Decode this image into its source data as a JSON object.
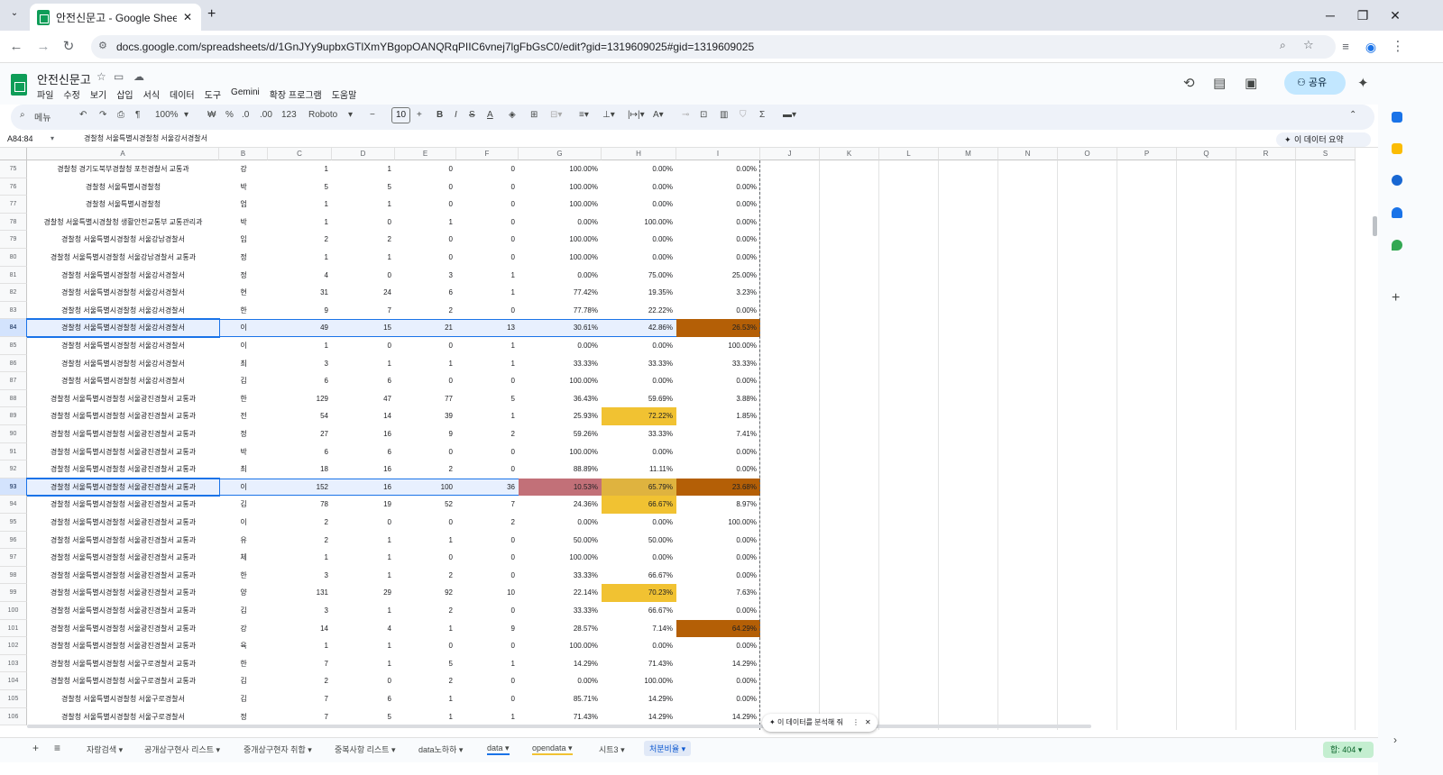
{
  "browser": {
    "tab_title": "안전신문고 - Google Sheets",
    "new_tab": "+",
    "url": "docs.google.com/spreadsheets/d/1GnJYy9upbxGTlXmYBgopOANQRqPIIC6vnej7lgFbGsC0/edit?gid=1319609025#gid=1319609025"
  },
  "app": {
    "title": "안전신문고",
    "menus": [
      "파일",
      "수정",
      "보기",
      "삽입",
      "서식",
      "데이터",
      "도구",
      "Gemini",
      "확장 프로그램",
      "도움말"
    ],
    "share_label": "공유"
  },
  "toolbar": {
    "search": "메뉴",
    "zoom": "100%",
    "currency": "₩",
    "percent": "%",
    "dec_down": ".0",
    "dec_up": ".00",
    "format_123": "123",
    "font": "Roboto",
    "font_size": "10"
  },
  "formula_bar": {
    "name_box": "A84:84",
    "content": "경찰청 서울특별시경찰청 서울강서경찰서",
    "summary_button": "이 데이터 요약"
  },
  "columns": [
    "A",
    "B",
    "C",
    "D",
    "E",
    "F",
    "G",
    "H",
    "I",
    "J",
    "K",
    "L",
    "M",
    "N",
    "O",
    "P",
    "Q",
    "R",
    "S"
  ],
  "rows": [
    {
      "n": "75",
      "a": "경찰청 경기도북부경찰청 포천경찰서 교통과",
      "b": "강",
      "c": "1",
      "d": "1",
      "e": "0",
      "f": "0",
      "g": "100.00%",
      "h": "0.00%",
      "i": "0.00%"
    },
    {
      "n": "76",
      "a": "경찰청 서울특별시경찰청",
      "b": "박",
      "c": "5",
      "d": "5",
      "e": "0",
      "f": "0",
      "g": "100.00%",
      "h": "0.00%",
      "i": "0.00%"
    },
    {
      "n": "77",
      "a": "경찰청 서울특별시경찰청",
      "b": "엄",
      "c": "1",
      "d": "1",
      "e": "0",
      "f": "0",
      "g": "100.00%",
      "h": "0.00%",
      "i": "0.00%"
    },
    {
      "n": "78",
      "a": "경찰청 서울특별시경찰청 생활안전교통부 교통관리과",
      "b": "박",
      "c": "1",
      "d": "0",
      "e": "1",
      "f": "0",
      "g": "0.00%",
      "h": "100.00%",
      "i": "0.00%"
    },
    {
      "n": "79",
      "a": "경찰청 서울특별시경찰청 서울강남경찰서",
      "b": "임",
      "c": "2",
      "d": "2",
      "e": "0",
      "f": "0",
      "g": "100.00%",
      "h": "0.00%",
      "i": "0.00%"
    },
    {
      "n": "80",
      "a": "경찰청 서울특별시경찰청 서울강남경찰서 교통과",
      "b": "정",
      "c": "1",
      "d": "1",
      "e": "0",
      "f": "0",
      "g": "100.00%",
      "h": "0.00%",
      "i": "0.00%"
    },
    {
      "n": "81",
      "a": "경찰청 서울특별시경찰청 서울강서경찰서",
      "b": "정",
      "c": "4",
      "d": "0",
      "e": "3",
      "f": "1",
      "g": "0.00%",
      "h": "75.00%",
      "i": "25.00%"
    },
    {
      "n": "82",
      "a": "경찰청 서울특별시경찰청 서울강서경찰서",
      "b": "현",
      "c": "31",
      "d": "24",
      "e": "6",
      "f": "1",
      "g": "77.42%",
      "h": "19.35%",
      "i": "3.23%"
    },
    {
      "n": "83",
      "a": "경찰청 서울특별시경찰청 서울강서경찰서",
      "b": "한",
      "c": "9",
      "d": "7",
      "e": "2",
      "f": "0",
      "g": "77.78%",
      "h": "22.22%",
      "i": "0.00%"
    },
    {
      "n": "84",
      "a": "경찰청 서울특별시경찰청 서울강서경찰서",
      "b": "이",
      "c": "49",
      "d": "15",
      "e": "21",
      "f": "13",
      "g": "30.61%",
      "h": "42.86%",
      "i": "26.53%",
      "sel": true,
      "hi": "orange"
    },
    {
      "n": "85",
      "a": "경찰청 서울특별시경찰청 서울강서경찰서",
      "b": "이",
      "c": "1",
      "d": "0",
      "e": "0",
      "f": "1",
      "g": "0.00%",
      "h": "0.00%",
      "i": "100.00%"
    },
    {
      "n": "86",
      "a": "경찰청 서울특별시경찰청 서울강서경찰서",
      "b": "최",
      "c": "3",
      "d": "1",
      "e": "1",
      "f": "1",
      "g": "33.33%",
      "h": "33.33%",
      "i": "33.33%"
    },
    {
      "n": "87",
      "a": "경찰청 서울특별시경찰청 서울강서경찰서",
      "b": "김",
      "c": "6",
      "d": "6",
      "e": "0",
      "f": "0",
      "g": "100.00%",
      "h": "0.00%",
      "i": "0.00%"
    },
    {
      "n": "88",
      "a": "경찰청 서울특별시경찰청 서울광진경찰서 교통과",
      "b": "한",
      "c": "129",
      "d": "47",
      "e": "77",
      "f": "5",
      "g": "36.43%",
      "h": "59.69%",
      "i": "3.88%"
    },
    {
      "n": "89",
      "a": "경찰청 서울특별시경찰청 서울광진경찰서 교통과",
      "b": "전",
      "c": "54",
      "d": "14",
      "e": "39",
      "f": "1",
      "g": "25.93%",
      "h": "72.22%",
      "i": "1.85%",
      "hh": "yellow"
    },
    {
      "n": "90",
      "a": "경찰청 서울특별시경찰청 서울광진경찰서 교통과",
      "b": "정",
      "c": "27",
      "d": "16",
      "e": "9",
      "f": "2",
      "g": "59.26%",
      "h": "33.33%",
      "i": "7.41%"
    },
    {
      "n": "91",
      "a": "경찰청 서울특별시경찰청 서울광진경찰서 교통과",
      "b": "박",
      "c": "6",
      "d": "6",
      "e": "0",
      "f": "0",
      "g": "100.00%",
      "h": "0.00%",
      "i": "0.00%"
    },
    {
      "n": "92",
      "a": "경찰청 서울특별시경찰청 서울광진경찰서 교통과",
      "b": "최",
      "c": "18",
      "d": "16",
      "e": "2",
      "f": "0",
      "g": "88.89%",
      "h": "11.11%",
      "i": "0.00%"
    },
    {
      "n": "93",
      "a": "경찰청 서울특별시경찰청 서울광진경찰서 교통과",
      "b": "이",
      "c": "152",
      "d": "16",
      "e": "100",
      "f": "36",
      "g": "10.53%",
      "h": "65.79%",
      "i": "23.68%",
      "sel": true,
      "hg": "red",
      "hh": "gold",
      "hi": "orange"
    },
    {
      "n": "94",
      "a": "경찰청 서울특별시경찰청 서울광진경찰서 교통과",
      "b": "김",
      "c": "78",
      "d": "19",
      "e": "52",
      "f": "7",
      "g": "24.36%",
      "h": "66.67%",
      "i": "8.97%",
      "hh": "yellow"
    },
    {
      "n": "95",
      "a": "경찰청 서울특별시경찰청 서울광진경찰서 교통과",
      "b": "이",
      "c": "2",
      "d": "0",
      "e": "0",
      "f": "2",
      "g": "0.00%",
      "h": "0.00%",
      "i": "100.00%"
    },
    {
      "n": "96",
      "a": "경찰청 서울특별시경찰청 서울광진경찰서 교통과",
      "b": "유",
      "c": "2",
      "d": "1",
      "e": "1",
      "f": "0",
      "g": "50.00%",
      "h": "50.00%",
      "i": "0.00%"
    },
    {
      "n": "97",
      "a": "경찰청 서울특별시경찰청 서울광진경찰서 교통과",
      "b": "체",
      "c": "1",
      "d": "1",
      "e": "0",
      "f": "0",
      "g": "100.00%",
      "h": "0.00%",
      "i": "0.00%"
    },
    {
      "n": "98",
      "a": "경찰청 서울특별시경찰청 서울광진경찰서 교통과",
      "b": "한",
      "c": "3",
      "d": "1",
      "e": "2",
      "f": "0",
      "g": "33.33%",
      "h": "66.67%",
      "i": "0.00%"
    },
    {
      "n": "99",
      "a": "경찰청 서울특별시경찰청 서울광진경찰서 교통과",
      "b": "양",
      "c": "131",
      "d": "29",
      "e": "92",
      "f": "10",
      "g": "22.14%",
      "h": "70.23%",
      "i": "7.63%",
      "hh": "yellow"
    },
    {
      "n": "100",
      "a": "경찰청 서울특별시경찰청 서울광진경찰서 교통과",
      "b": "김",
      "c": "3",
      "d": "1",
      "e": "2",
      "f": "0",
      "g": "33.33%",
      "h": "66.67%",
      "i": "0.00%"
    },
    {
      "n": "101",
      "a": "경찰청 서울특별시경찰청 서울광진경찰서 교통과",
      "b": "강",
      "c": "14",
      "d": "4",
      "e": "1",
      "f": "9",
      "g": "28.57%",
      "h": "7.14%",
      "i": "64.29%",
      "hi": "orange"
    },
    {
      "n": "102",
      "a": "경찰청 서울특별시경찰청 서울광진경찰서 교통과",
      "b": "육",
      "c": "1",
      "d": "1",
      "e": "0",
      "f": "0",
      "g": "100.00%",
      "h": "0.00%",
      "i": "0.00%"
    },
    {
      "n": "103",
      "a": "경찰청 서울특별시경찰청 서울구로경찰서 교통과",
      "b": "한",
      "c": "7",
      "d": "1",
      "e": "5",
      "f": "1",
      "g": "14.29%",
      "h": "71.43%",
      "i": "14.29%"
    },
    {
      "n": "104",
      "a": "경찰청 서울특별시경찰청 서울구로경찰서 교통과",
      "b": "김",
      "c": "2",
      "d": "0",
      "e": "2",
      "f": "0",
      "g": "0.00%",
      "h": "100.00%",
      "i": "0.00%"
    },
    {
      "n": "105",
      "a": "경찰청 서울특별시경찰청 서울구로경찰서",
      "b": "김",
      "c": "7",
      "d": "6",
      "e": "1",
      "f": "0",
      "g": "85.71%",
      "h": "14.29%",
      "i": "0.00%"
    },
    {
      "n": "106",
      "a": "경찰청 서울특별시경찰청 서울구로경찰서",
      "b": "정",
      "c": "7",
      "d": "5",
      "e": "1",
      "f": "1",
      "g": "71.43%",
      "h": "14.29%",
      "i": "14.29%"
    }
  ],
  "ai_pill": "이 데이터를 분석해 줘",
  "sheet_tabs": [
    "자랑검색",
    "공개상구현사 리스트",
    "중개상구현자 취합",
    "중복사항 리스트",
    "data노하하",
    "data",
    "opendata",
    "시트3",
    "처분비율"
  ],
  "active_sheet": "처분비율",
  "sum_chip": "합: 404",
  "colors": {
    "orange": "#b45f06",
    "yellow": "#f1c232",
    "gold": "#dfb33f",
    "red": "#c27078",
    "selection": "#1a73e8"
  }
}
